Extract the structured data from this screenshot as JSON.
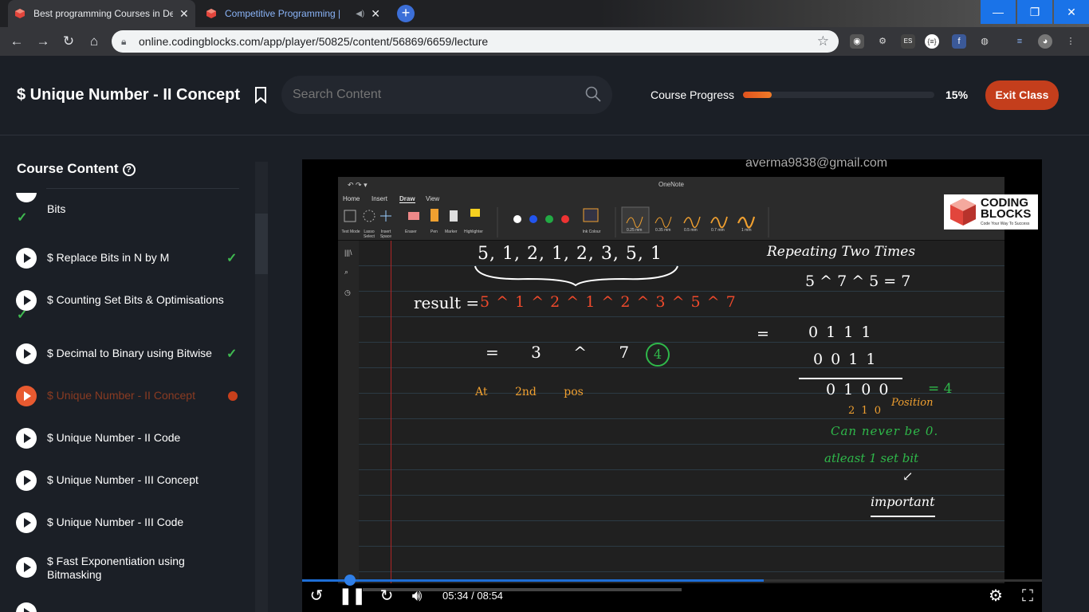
{
  "browser": {
    "tabs": [
      {
        "title": "Best programming Courses in De",
        "active": true
      },
      {
        "title": "Competitive Programming |",
        "active": false
      }
    ],
    "url": "online.codingblocks.com/app/player/50825/content/56869/6659/lecture",
    "window_buttons": [
      "minimize",
      "restore",
      "close"
    ]
  },
  "header": {
    "title": "$ Unique Number - II Concept",
    "search_placeholder": "Search Content",
    "progress_label": "Course Progress",
    "progress_value": 0.15,
    "progress_text": "15%",
    "exit_label": "Exit Class"
  },
  "sidebar": {
    "title": "Course Content",
    "items": [
      {
        "label": "Bits",
        "completed": true,
        "active": false
      },
      {
        "label": "$ Replace Bits in N by M",
        "completed": true,
        "active": false
      },
      {
        "label": "$ Counting Set Bits & Optimisations",
        "completed": true,
        "active": false
      },
      {
        "label": "$ Decimal to Binary using Bitwise",
        "completed": true,
        "active": false
      },
      {
        "label": "$ Unique Number - II Concept",
        "completed": false,
        "active": true
      },
      {
        "label": "$ Unique Number - II Code",
        "completed": false,
        "active": false
      },
      {
        "label": "$ Unique Number - III Concept",
        "completed": false,
        "active": false
      },
      {
        "label": "$ Unique Number - III Code",
        "completed": false,
        "active": false
      },
      {
        "label": "$ Fast Exponentiation using Bitmasking",
        "completed": false,
        "active": false
      }
    ]
  },
  "video": {
    "watermark": "averma9838@gmail.com",
    "time": "05:34 / 08:54",
    "seek_fraction": 0.624,
    "onenote": {
      "app_title": "OneNote",
      "tabs": [
        "Home",
        "Insert",
        "Draw",
        "View"
      ],
      "tools": [
        "Text Mode",
        "Lasso Select",
        "Insert Space",
        "Eraser",
        "Pen",
        "Marker",
        "Highlighter",
        "Ink Colour"
      ],
      "pen_sizes": [
        "0.25 mm",
        "0.35 mm",
        "0.5 mm",
        "0.7 mm",
        "1 mm"
      ],
      "logo_line1": "CODING",
      "logo_line2": "BLOCKS",
      "logo_tagline": "Code Your Way To Success"
    },
    "handwriting": {
      "array": "5, 1, 2, 1, 2, 3, 5, 1",
      "result": "result =",
      "xor_chain": "5 ^ 1 ^ 2 ^ 1 ^ 2 ^ 3 ^ 5 ^ 7",
      "equals_line": "= 3 ^ 7",
      "circled_four": "4",
      "at_line": "At 2nd pos",
      "heading": "Repeating Two Times",
      "xor_example": "5 ^ 7 ^ 5 = 7",
      "b1": "0 1 1 1",
      "b2": "0 0 1 1",
      "b3": "0 1 0 0",
      "pos": "2 1 0",
      "position_word": "Position",
      "eq4": "= 4",
      "never": "Can never be 0.",
      "atleast": "atleast 1 set bit",
      "important": "important"
    }
  }
}
